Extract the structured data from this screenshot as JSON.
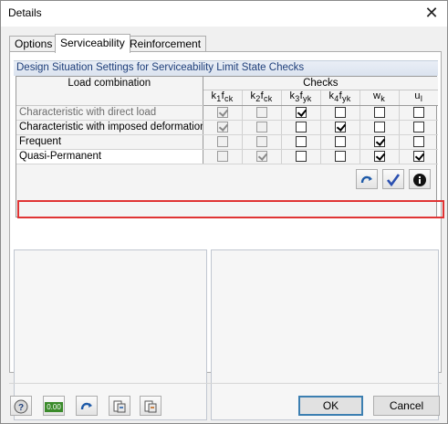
{
  "window": {
    "title": "Details",
    "close_glyph": "✕"
  },
  "tabs": [
    {
      "label": "Options"
    },
    {
      "label": "Serviceability"
    },
    {
      "label": "Reinforcement"
    }
  ],
  "active_tab": "Serviceability",
  "section_title": "Design Situation Settings for Serviceability Limit State Checks",
  "grid": {
    "load_combination_header": "Load combination",
    "checks_header": "Checks",
    "check_columns": [
      {
        "main": "k",
        "idx": "1",
        "f": "f",
        "sub": "ck"
      },
      {
        "main": "k",
        "idx": "2",
        "f": "f",
        "sub": "ck"
      },
      {
        "main": "k",
        "idx": "3",
        "f": "f",
        "sub": "yk"
      },
      {
        "main": "k",
        "idx": "4",
        "f": "f",
        "sub": "yk"
      },
      {
        "main": "w",
        "idx": "",
        "f": "",
        "sub": "k"
      },
      {
        "main": "u",
        "idx": "",
        "f": "",
        "sub": "l"
      }
    ],
    "rows": [
      {
        "name": "Characteristic with direct load",
        "enabled_name": false,
        "checks": [
          {
            "on": true,
            "enabled": false
          },
          {
            "on": false,
            "enabled": false
          },
          {
            "on": true,
            "enabled": true
          },
          {
            "on": false,
            "enabled": true
          },
          {
            "on": false,
            "enabled": true
          },
          {
            "on": false,
            "enabled": true
          }
        ]
      },
      {
        "name": "Characteristic with imposed deformation",
        "enabled_name": true,
        "checks": [
          {
            "on": true,
            "enabled": false
          },
          {
            "on": false,
            "enabled": false
          },
          {
            "on": false,
            "enabled": true
          },
          {
            "on": true,
            "enabled": true
          },
          {
            "on": false,
            "enabled": true
          },
          {
            "on": false,
            "enabled": true
          }
        ]
      },
      {
        "name": "Frequent",
        "enabled_name": true,
        "checks": [
          {
            "on": false,
            "enabled": false
          },
          {
            "on": false,
            "enabled": false
          },
          {
            "on": false,
            "enabled": true
          },
          {
            "on": false,
            "enabled": true
          },
          {
            "on": true,
            "enabled": true
          },
          {
            "on": false,
            "enabled": true
          }
        ]
      },
      {
        "name": "Quasi-Permanent",
        "enabled_name": true,
        "checks": [
          {
            "on": false,
            "enabled": false
          },
          {
            "on": true,
            "enabled": false
          },
          {
            "on": false,
            "enabled": true
          },
          {
            "on": false,
            "enabled": true
          },
          {
            "on": true,
            "enabled": true
          },
          {
            "on": true,
            "enabled": true
          }
        ]
      }
    ]
  },
  "grid_toolbar": [
    {
      "icon": "reset-icon"
    },
    {
      "icon": "check-icon"
    },
    {
      "icon": "info-icon"
    }
  ],
  "footer": {
    "icons": [
      "help-icon",
      "units-icon",
      "reset-icon",
      "export-icon",
      "import-icon"
    ],
    "units_text": "0.00",
    "ok_label": "OK",
    "cancel_label": "Cancel"
  },
  "colors": {
    "highlight": "#e03434",
    "section_text": "#1f3f7a",
    "default_button_border": "#3c7fb1"
  }
}
